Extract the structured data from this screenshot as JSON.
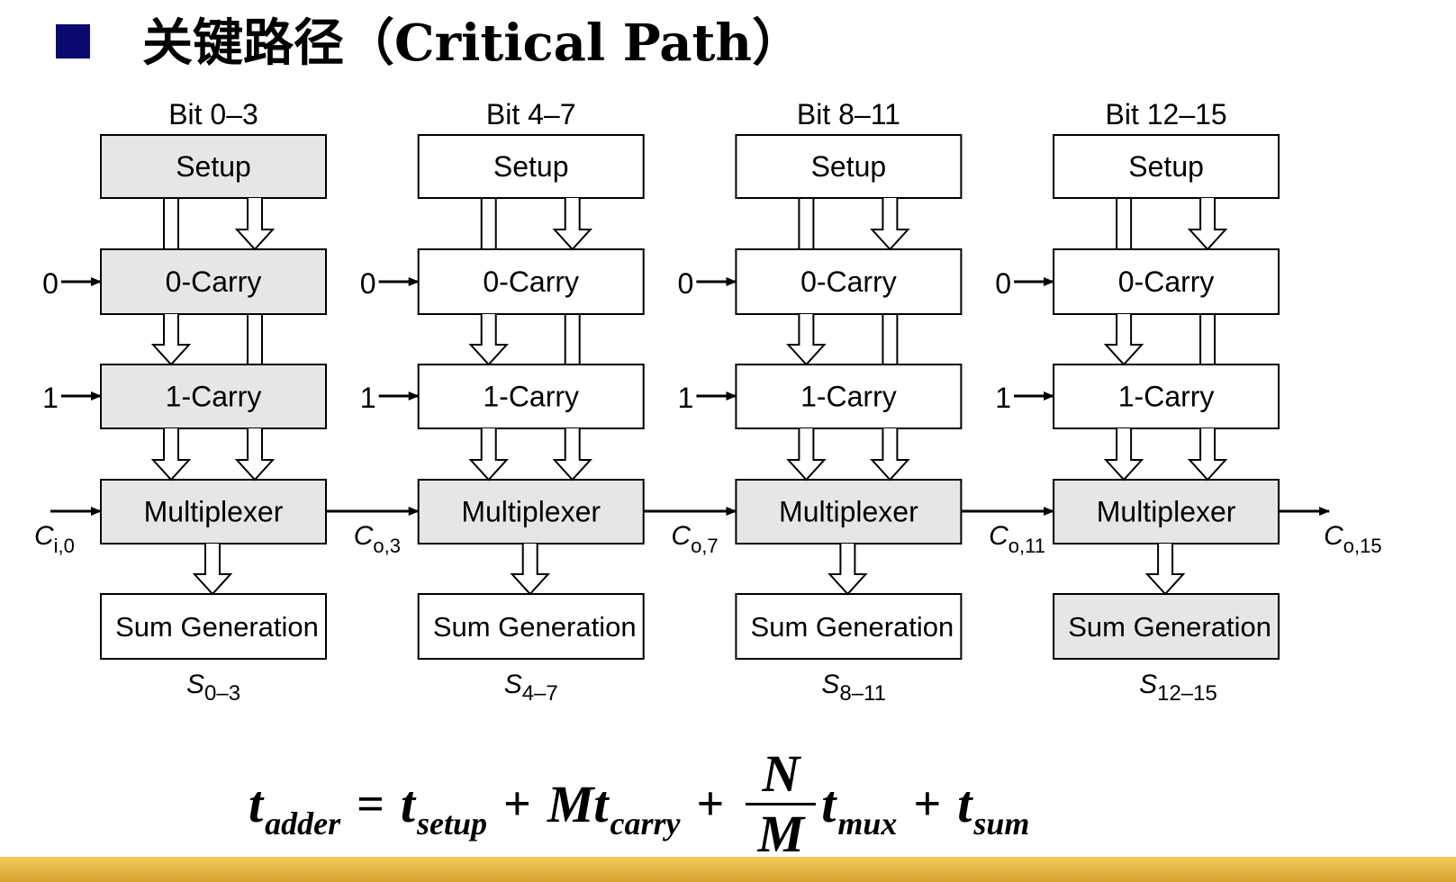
{
  "header": {
    "title": "关键路径（Critical Path）"
  },
  "diagram": {
    "blocks": [
      {
        "bit_label": "Bit 0–3",
        "setup": "Setup",
        "carry0": "0-Carry",
        "carry1": "1-Carry",
        "mux": "Multiplexer",
        "sum": "Sum Generation",
        "sum_out": "S",
        "sum_sub": "0–3",
        "shaded": [
          true,
          true,
          true,
          true,
          false
        ]
      },
      {
        "bit_label": "Bit 4–7",
        "setup": "Setup",
        "carry0": "0-Carry",
        "carry1": "1-Carry",
        "mux": "Multiplexer",
        "sum": "Sum Generation",
        "sum_out": "S",
        "sum_sub": "4–7",
        "shaded": [
          false,
          false,
          false,
          true,
          false
        ]
      },
      {
        "bit_label": "Bit 8–11",
        "setup": "Setup",
        "carry0": "0-Carry",
        "carry1": "1-Carry",
        "mux": "Multiplexer",
        "sum": "Sum Generation",
        "sum_out": "S",
        "sum_sub": "8–11",
        "shaded": [
          false,
          false,
          false,
          true,
          false
        ]
      },
      {
        "bit_label": "Bit 12–15",
        "setup": "Setup",
        "carry0": "0-Carry",
        "carry1": "1-Carry",
        "mux": "Multiplexer",
        "sum": "Sum Generation",
        "sum_out": "S",
        "sum_sub": "12–15",
        "shaded": [
          false,
          false,
          false,
          true,
          true
        ]
      }
    ],
    "carry_in_zero": "0",
    "carry_in_one": "1",
    "carry_labels": [
      {
        "base": "C",
        "sub": "i,0"
      },
      {
        "base": "C",
        "sub": "o,3"
      },
      {
        "base": "C",
        "sub": "o,7"
      },
      {
        "base": "C",
        "sub": "o,11"
      },
      {
        "base": "C",
        "sub": "o,15"
      }
    ],
    "colors": {
      "shaded_fill": "#e6e6e6",
      "plain_fill": "#ffffff",
      "stroke": "#000000"
    }
  },
  "formula": {
    "lhs": "t",
    "lhs_sub": "adder",
    "eq": "=",
    "t1": "t",
    "t1_sub": "setup",
    "plus1": "+",
    "t2": "Mt",
    "t2_sub": "carry",
    "plus2": "+",
    "frac_num": "N",
    "frac_den": "M",
    "t3": "t",
    "t3_sub": "mux",
    "plus3": "+",
    "t4": "t",
    "t4_sub": "sum"
  },
  "theme": {
    "bullet_color": "#0a0a6e",
    "band_color": "#e0b040"
  }
}
